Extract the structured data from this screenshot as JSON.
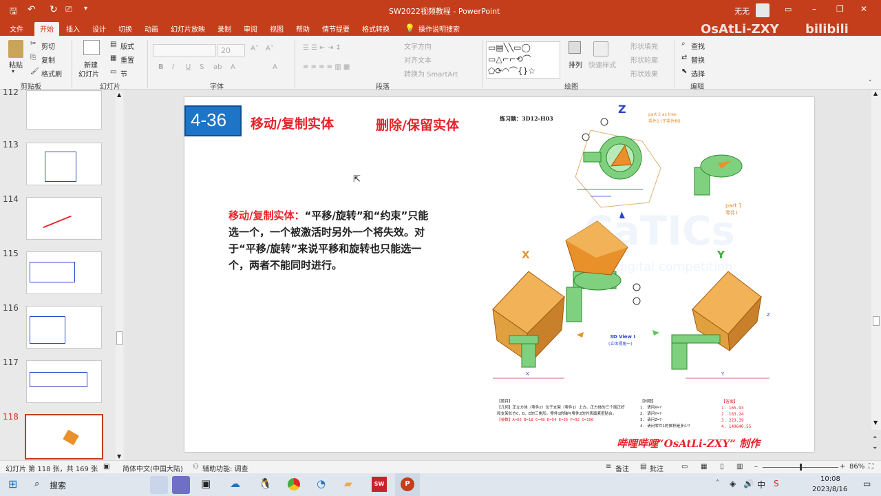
{
  "titlebar": {
    "doc_title": "SW2022视频教程 - PowerPoint",
    "user": "无无",
    "minimize": "–",
    "restore": "❐",
    "close": "✕"
  },
  "menu": {
    "tabs": [
      "文件",
      "开始",
      "插入",
      "设计",
      "切换",
      "动画",
      "幻灯片放映",
      "录制",
      "审阅",
      "视图",
      "帮助",
      "情节提要",
      "格式转换"
    ],
    "tell_me": "操作说明搜索",
    "watermark": "OsAtLi-ZXY"
  },
  "ribbon": {
    "clipboard": {
      "paste": "粘贴",
      "cut": "剪切",
      "copy": "复制",
      "format_painter": "格式刷",
      "group": "剪贴板"
    },
    "slides": {
      "new_slide": "新建",
      "new_slide2": "幻灯片",
      "layout": "版式",
      "reset": "重置",
      "section": "节",
      "group": "幻灯片"
    },
    "font": {
      "size": "20",
      "bold": "B",
      "italic": "I",
      "underline": "U",
      "strike": "S",
      "group": "字体"
    },
    "paragraph": {
      "text_direction": "文字方向",
      "align_text": "对齐文本",
      "smartart": "转换为 SmartArt",
      "group": "段落"
    },
    "drawing": {
      "arrange": "排列",
      "quick_styles": "快速样式",
      "shape_fill": "形状填充",
      "shape_outline": "形状轮廓",
      "shape_effects": "形状效果",
      "group": "绘图"
    },
    "editing": {
      "find": "查找",
      "replace": "替换",
      "select": "选择",
      "group": "编辑"
    }
  },
  "thumbnails": [
    {
      "num": "112"
    },
    {
      "num": "113"
    },
    {
      "num": "114"
    },
    {
      "num": "115"
    },
    {
      "num": "116"
    },
    {
      "num": "117"
    },
    {
      "num": "118"
    }
  ],
  "slide": {
    "badge": "4-36",
    "title1": "移动/复制实体",
    "title2": "删除/保留实体",
    "exercise": "练习题：3D12-H03",
    "body_red": "移动/复制实体：",
    "body_black": "“平移/旋转”和“约束”只能选一个，一个被激活时另外一个将失效。对于“平移/旋转”来说平移和旋转也只能选一个，两者不能同时进行。",
    "label_z": "Z",
    "label_x": "X",
    "label_y": "Y",
    "part_name": "part 1",
    "part_name_cn": "零件1",
    "part2_name": "part 2 as tree",
    "part2_name_cn": "零件2 (子零件树)",
    "view_name": "3D View I",
    "view_name_cn": "(立体视角一)",
    "dim_x": "X",
    "dim_y": "Y",
    "dim_z": "Z",
    "problem_header": "【题目】",
    "problem_text": "【几何】正立方体（零件2）位于支架（零件1）上方。正方体的三个面正好和支架长方C、D、E的三角形。零件1的轴与零件2的外表面紧密贴合。",
    "params": "【参数】A=56 B=18 C=48 D=54 E=55 F=92 G=100",
    "questions_header": "【问题】",
    "questions": [
      "1. 请问X=?",
      "2. 请问Y=?",
      "3. 请问Z=?",
      "4. 请问零件1的体积是多少?"
    ],
    "answers_header": "【答案】",
    "answers": [
      "1. 165.93",
      "2. 183.24",
      "3. 223.39",
      "4. 149640.55"
    ],
    "credit": "哔哩哔哩“OsAtLi-ZXY” 制作",
    "logo_text": "CaTICs",
    "logo_sub": "CAD-digital competition"
  },
  "statusbar": {
    "slide_info": "幻灯片 第 118 张，共 169 张",
    "language": "简体中文(中国大陆)",
    "accessibility": "辅助功能: 调查",
    "notes": "备注",
    "comments": "批注",
    "zoom": "86%"
  },
  "taskbar": {
    "search": "搜索",
    "time": "10:08",
    "date": "2023/8/16",
    "ime": "中"
  },
  "colors": {
    "accent": "#c43e1c",
    "badge_blue": "#1e74c6",
    "title_red": "#e8232a",
    "green": "#5cc75c",
    "orange": "#e8902a"
  }
}
